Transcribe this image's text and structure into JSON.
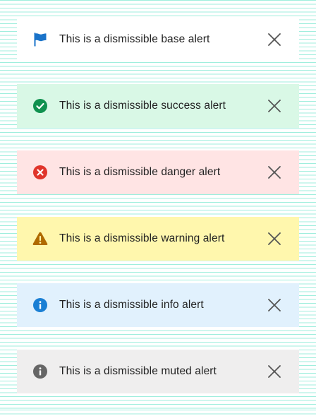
{
  "alerts": [
    {
      "variant": "base",
      "text": "This is a dismissible base alert",
      "icon": "flag-icon",
      "icon_color": "#1a73c9"
    },
    {
      "variant": "success",
      "text": "This is a dismissible success alert",
      "icon": "check-circle-icon",
      "icon_color": "#10914f"
    },
    {
      "variant": "danger",
      "text": "This is a dismissible danger alert",
      "icon": "x-circle-icon",
      "icon_color": "#e0352b"
    },
    {
      "variant": "warning",
      "text": "This is a dismissible warning alert",
      "icon": "warning-triangle-icon",
      "icon_color": "#b06a00"
    },
    {
      "variant": "info",
      "text": "This is a dismissible info alert",
      "icon": "info-circle-icon",
      "icon_color": "#1a7fd4"
    },
    {
      "variant": "muted",
      "text": "This is a dismissible muted alert",
      "icon": "info-circle-icon",
      "icon_color": "#666666"
    }
  ],
  "colors": {
    "text": "#222222",
    "close_icon": "#555555",
    "background_stripe": "#9feedd"
  }
}
